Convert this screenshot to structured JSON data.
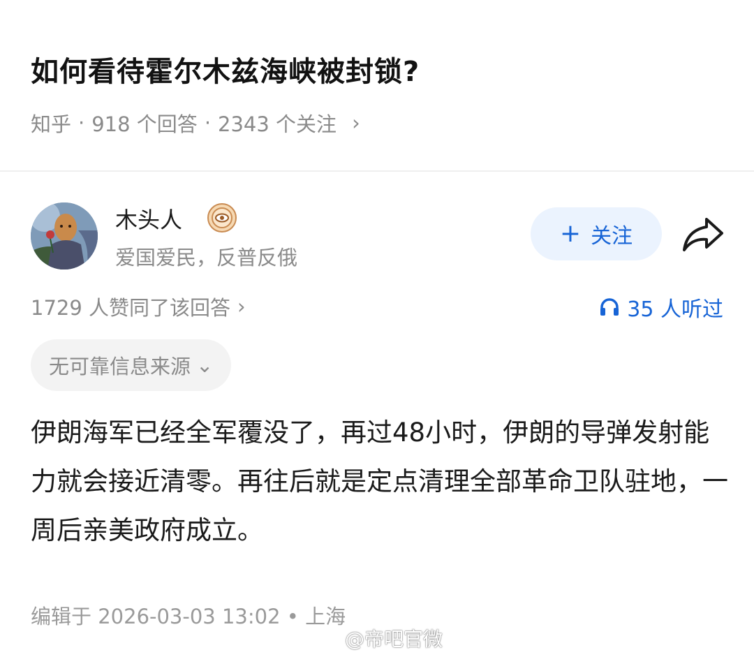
{
  "question": {
    "title": "如何看待霍尔木兹海峡被封锁?",
    "source": "知乎",
    "separator": "·",
    "answers_count": "918 个回答",
    "followers_count": "2343 个关注",
    "chevron": "›"
  },
  "author": {
    "name": "木头人",
    "bio": "爱国爱民，反普反俄",
    "avatar_icon": "avatar-illustration",
    "badge_icon": "eye-badge-icon"
  },
  "actions": {
    "follow_plus": "+",
    "follow_label": "关注",
    "share_icon": "share-arrow-icon"
  },
  "stats": {
    "likes_text": "1729 人赞同了该回答",
    "likes_chevron": "›",
    "listen_text": "35 人听过",
    "listen_icon": "headphones-icon"
  },
  "source_chip": {
    "label": "无可靠信息来源",
    "chevron": "⌄"
  },
  "answer": {
    "text": "伊朗海军已经全军覆没了，再过48小时，伊朗的导弹发射能力就会接近清零。再往后就是定点清理全部革命卫队驻地，一周后亲美政府成立。"
  },
  "footer": {
    "edit_text": "编辑于 2026-03-03 13:02 • 上海",
    "watermark": "@帝吧官微"
  },
  "colors": {
    "accent": "#1764d6",
    "follow_bg": "#ebf3fe",
    "meta_text": "#8a8a8a",
    "chip_bg": "#f3f3f3"
  }
}
